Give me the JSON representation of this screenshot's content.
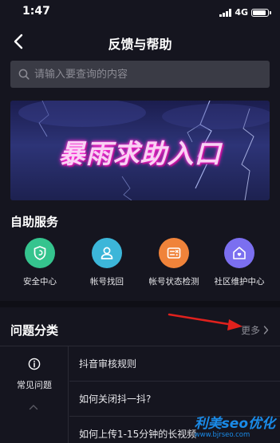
{
  "status_bar": {
    "time": "1:47",
    "network": "4G",
    "battery_level": 0.9
  },
  "nav": {
    "title": "反馈与帮助",
    "back_icon": "chevron-left-icon"
  },
  "search": {
    "placeholder": "请输入要查询的内容",
    "value": "",
    "icon": "search-icon"
  },
  "banner": {
    "text": "暴雨求助入口"
  },
  "self_service": {
    "title": "自助服务",
    "items": [
      {
        "label": "安全中心",
        "icon": "shield-icon",
        "color": "#35c48e"
      },
      {
        "label": "帐号找回",
        "icon": "user-icon",
        "color": "#3cb6d9"
      },
      {
        "label": "帐号状态检测",
        "icon": "status-check-icon",
        "color": "#f0833a"
      },
      {
        "label": "社区维护中心",
        "icon": "home-heart-icon",
        "color": "#7b6ff0"
      }
    ]
  },
  "categories": {
    "title": "问题分类",
    "more_label": "更多",
    "side_item": {
      "label": "常见问题",
      "icon": "info-icon"
    },
    "questions": [
      "抖音审核规则",
      "如何关闭抖一抖?",
      "如何上传1-15分钟的长视频"
    ]
  },
  "watermark": {
    "title": "利美seo优化",
    "url": "www.bjrseo.com"
  },
  "colors": {
    "background": "#15151f",
    "search_bg": "#3a3b45",
    "annotation_arrow": "#e0211d"
  }
}
